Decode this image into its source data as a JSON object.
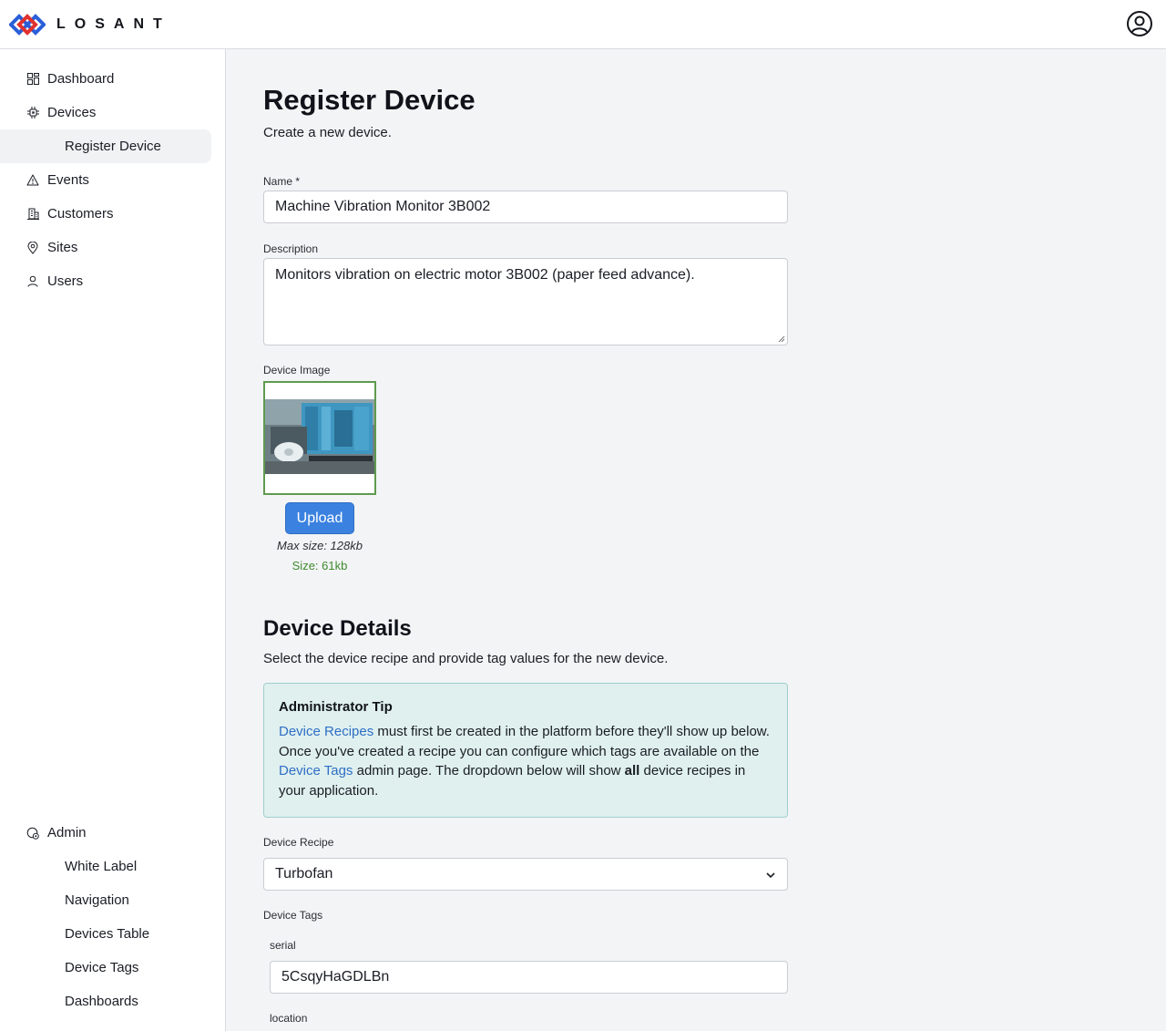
{
  "brand": {
    "name": "LOSANT",
    "accent_red": "#e0312f",
    "accent_blue": "#2a5fd8"
  },
  "sidebar": {
    "items": [
      {
        "label": "Dashboard",
        "icon": "grid-icon"
      },
      {
        "label": "Devices",
        "icon": "chip-icon"
      },
      {
        "label": "Register Device",
        "active": true
      },
      {
        "label": "Events",
        "icon": "warning-icon"
      },
      {
        "label": "Customers",
        "icon": "building-icon"
      },
      {
        "label": "Sites",
        "icon": "map-pin-icon"
      },
      {
        "label": "Users",
        "icon": "user-icon"
      }
    ],
    "admin": {
      "label": "Admin",
      "icon": "admin-gear-icon",
      "items": [
        "White Label",
        "Navigation",
        "Devices Table",
        "Device Tags",
        "Dashboards"
      ]
    }
  },
  "page": {
    "title": "Register Device",
    "subtitle": "Create a new device."
  },
  "form": {
    "name_label": "Name *",
    "name_value": "Machine Vibration Monitor 3B002",
    "description_label": "Description",
    "description_value": "Monitors vibration on electric motor 3B002 (paper feed advance).",
    "image_label": "Device Image",
    "upload_label": "Upload",
    "max_size": "Max size: 128kb",
    "size": "Size: 61kb"
  },
  "details": {
    "title": "Device Details",
    "subtitle": "Select the device recipe and provide tag values for the new device.",
    "tip": {
      "title": "Administrator Tip",
      "link1": "Device Recipes",
      "text1": " must first be created in the platform before they'll show up below. Once you've created a recipe you can configure which tags are available on the ",
      "link2": "Device Tags",
      "text2": " admin page. The dropdown below will show ",
      "bold": "all",
      "text3": " device recipes in your application."
    },
    "recipe_label": "Device Recipe",
    "recipe_value": "Turbofan",
    "tags_label": "Device Tags",
    "tags": [
      {
        "name": "serial",
        "value": "5CsqyHaGDLBn"
      },
      {
        "name": "location",
        "value": ""
      }
    ]
  }
}
